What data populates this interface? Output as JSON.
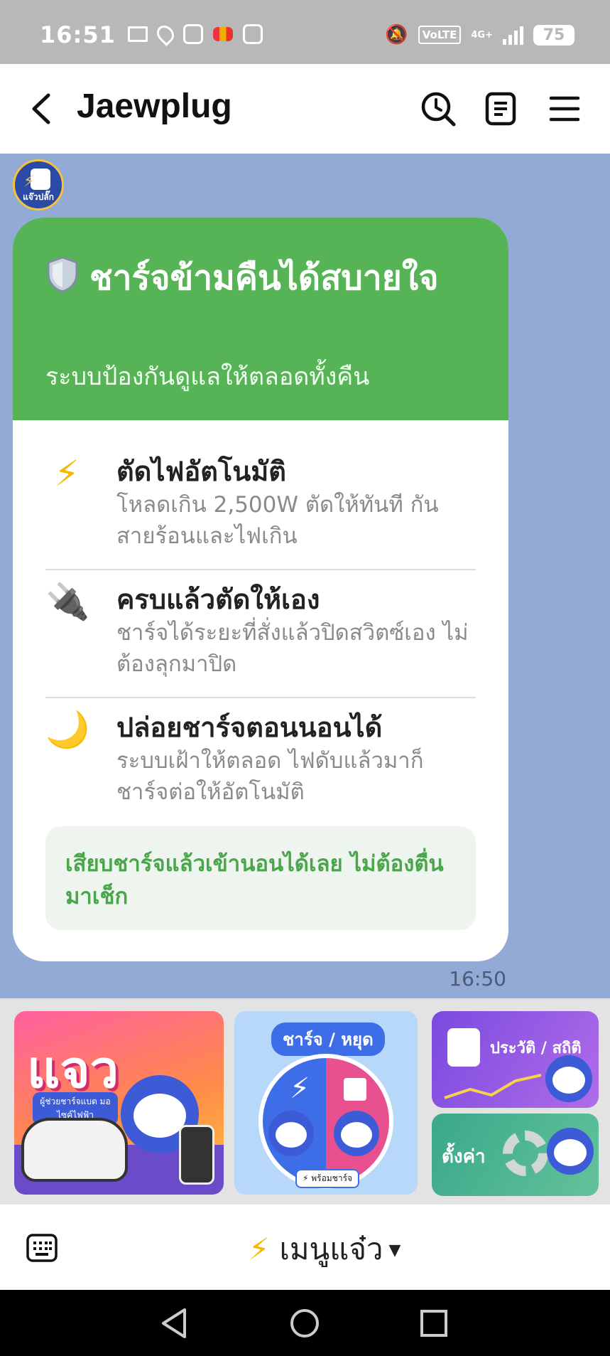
{
  "status_bar": {
    "time": "16:51",
    "volte": "VoLTE",
    "network": "4G+",
    "battery": "75"
  },
  "header": {
    "title": "Jaewplug"
  },
  "chat": {
    "avatar_label": "แจ๊วปลั๊ก",
    "card": {
      "title": "ชาร์จข้ามคืนได้สบายใจ",
      "subtitle": "ระบบป้องกันดูแลให้ตลอดทั้งคืน",
      "features": [
        {
          "icon": "⚡",
          "title": "ตัดไฟอัตโนมัติ",
          "desc": "โหลดเกิน 2,500W ตัดให้ทันที กันสายร้อนและไฟเกิน"
        },
        {
          "icon": "🔌",
          "title": "ครบแล้วตัดให้เอง",
          "desc": "ชาร์จได้ระยะที่สั่งแล้วปิดสวิตซ์เอง ไม่ต้องลุกมาปิด"
        },
        {
          "icon": "🌙",
          "title": "ปล่อยชาร์จตอนนอนได้",
          "desc": "ระบบเฝ้าให้ตลอด ไฟดับแล้วมาก็ชาร์จต่อให้อัตโนมัติ"
        }
      ],
      "note": "เสียบชาร์จแล้วเข้านอนได้เลย ไม่ต้องตื่นมาเช็ก"
    },
    "timestamp": "16:50"
  },
  "rich_menu": {
    "tile_a_title": "แจว",
    "tile_a_caption": "ผู้ช่วยชาร์จแบต มอไซค์ไฟฟ้า",
    "tile_b_title": "ชาร์จ / หยุด",
    "tile_b_badge": "⚡ พร้อมชาร์จ",
    "tile_c_title": "ประวัติ / สถิติ",
    "tile_d_title": "ตั้งค่า"
  },
  "bottom_bar": {
    "menu_label": "เมนูแจ๋ว"
  },
  "colors": {
    "chat_bg": "#93a9d6",
    "card_header": "#56b356",
    "note_text": "#4aa64a"
  }
}
